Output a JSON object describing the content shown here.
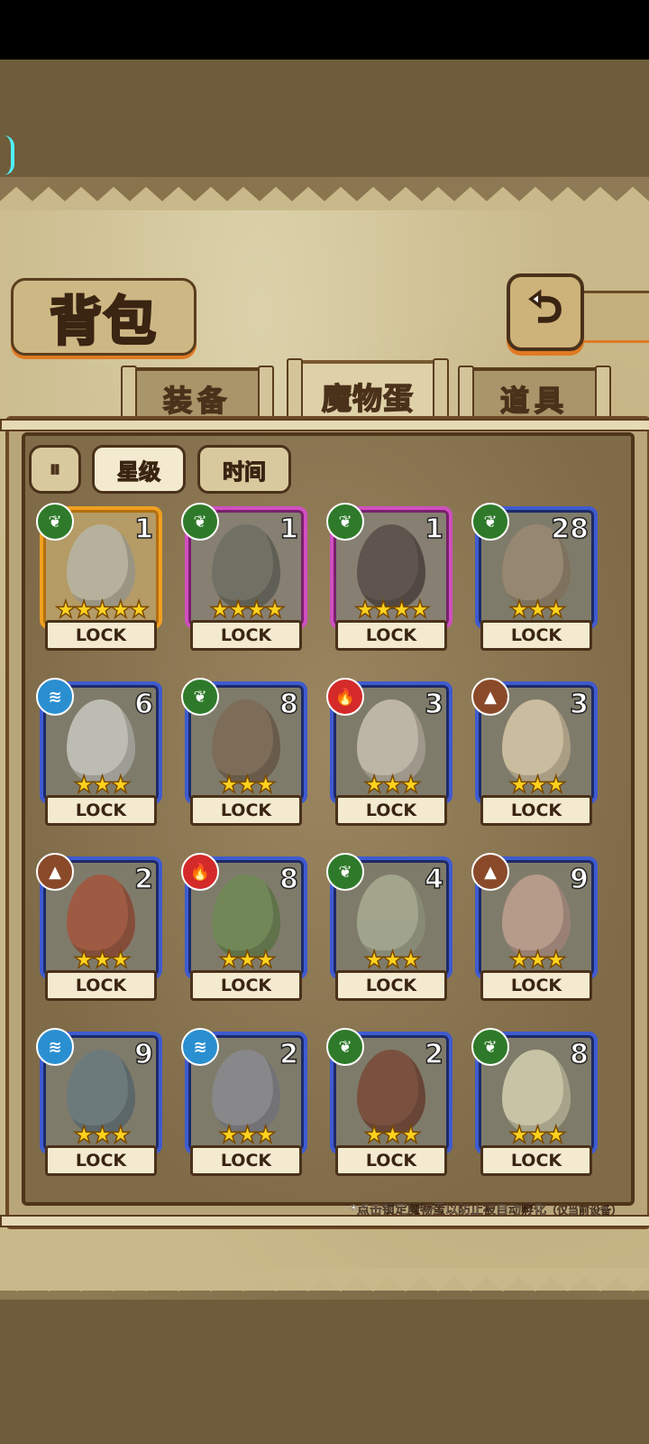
{
  "header": {
    "title": "背包",
    "back_icon": "back-arrow-icon"
  },
  "tabs": [
    {
      "label": "装备",
      "active": false
    },
    {
      "label": "魔物蛋",
      "active": true
    },
    {
      "label": "道具",
      "active": false
    }
  ],
  "sort": {
    "toggle_icon": "sort-toggle-icon",
    "toggle_glyph": "⏸",
    "options": [
      {
        "label": "星级",
        "active": true
      },
      {
        "label": "时间",
        "active": false
      }
    ]
  },
  "eggs": [
    {
      "element": "leaf",
      "count": "1",
      "stars": 5,
      "rarity": "gold",
      "lock": "LOCK",
      "color": "#b7b5a6"
    },
    {
      "element": "leaf",
      "count": "1",
      "stars": 4,
      "rarity": "pink",
      "lock": "LOCK",
      "color": "#6e6e63"
    },
    {
      "element": "leaf",
      "count": "1",
      "stars": 4,
      "rarity": "pink",
      "lock": "LOCK",
      "color": "#5a4e48"
    },
    {
      "element": "leaf",
      "count": "28",
      "stars": 3,
      "rarity": "blue",
      "lock": "LOCK",
      "color": "#9a8a72"
    },
    {
      "element": "water",
      "count": "6",
      "stars": 3,
      "rarity": "blue",
      "lock": "LOCK",
      "color": "#c8c8c0"
    },
    {
      "element": "leaf",
      "count": "8",
      "stars": 3,
      "rarity": "blue",
      "lock": "LOCK",
      "color": "#7d6a55"
    },
    {
      "element": "fire",
      "count": "3",
      "stars": 3,
      "rarity": "blue",
      "lock": "LOCK",
      "color": "#c8c0b0"
    },
    {
      "element": "earth",
      "count": "3",
      "stars": 3,
      "rarity": "blue",
      "lock": "LOCK",
      "color": "#d8c8a8"
    },
    {
      "element": "earth",
      "count": "2",
      "stars": 3,
      "rarity": "blue",
      "lock": "LOCK",
      "color": "#a4553c"
    },
    {
      "element": "fire",
      "count": "8",
      "stars": 3,
      "rarity": "blue",
      "lock": "LOCK",
      "color": "#6f8a55"
    },
    {
      "element": "leaf",
      "count": "4",
      "stars": 3,
      "rarity": "blue",
      "lock": "LOCK",
      "color": "#a8ac92"
    },
    {
      "element": "earth",
      "count": "9",
      "stars": 3,
      "rarity": "blue",
      "lock": "LOCK",
      "color": "#c0a090"
    },
    {
      "element": "water",
      "count": "9",
      "stars": 3,
      "rarity": "blue",
      "lock": "LOCK",
      "color": "#6a7a80"
    },
    {
      "element": "water",
      "count": "2",
      "stars": 3,
      "rarity": "blue",
      "lock": "LOCK",
      "color": "#8a8a90"
    },
    {
      "element": "leaf",
      "count": "2",
      "stars": 3,
      "rarity": "blue",
      "lock": "LOCK",
      "color": "#7a4a38"
    },
    {
      "element": "leaf",
      "count": "8",
      "stars": 3,
      "rarity": "blue",
      "lock": "LOCK",
      "color": "#d4d0b0"
    }
  ],
  "elements": {
    "leaf": {
      "icon": "leaf-element-icon",
      "color": "#2f7a2a"
    },
    "water": {
      "icon": "water-element-icon",
      "color": "#2a8fd0"
    },
    "fire": {
      "icon": "fire-element-icon",
      "color": "#d42a2a"
    },
    "earth": {
      "icon": "earth-element-icon",
      "color": "#8a4a2a"
    }
  },
  "footer_note": {
    "main": "*点击锁定魔物蛋以防止被自动孵化",
    "sub": "（仅当前设备）"
  }
}
